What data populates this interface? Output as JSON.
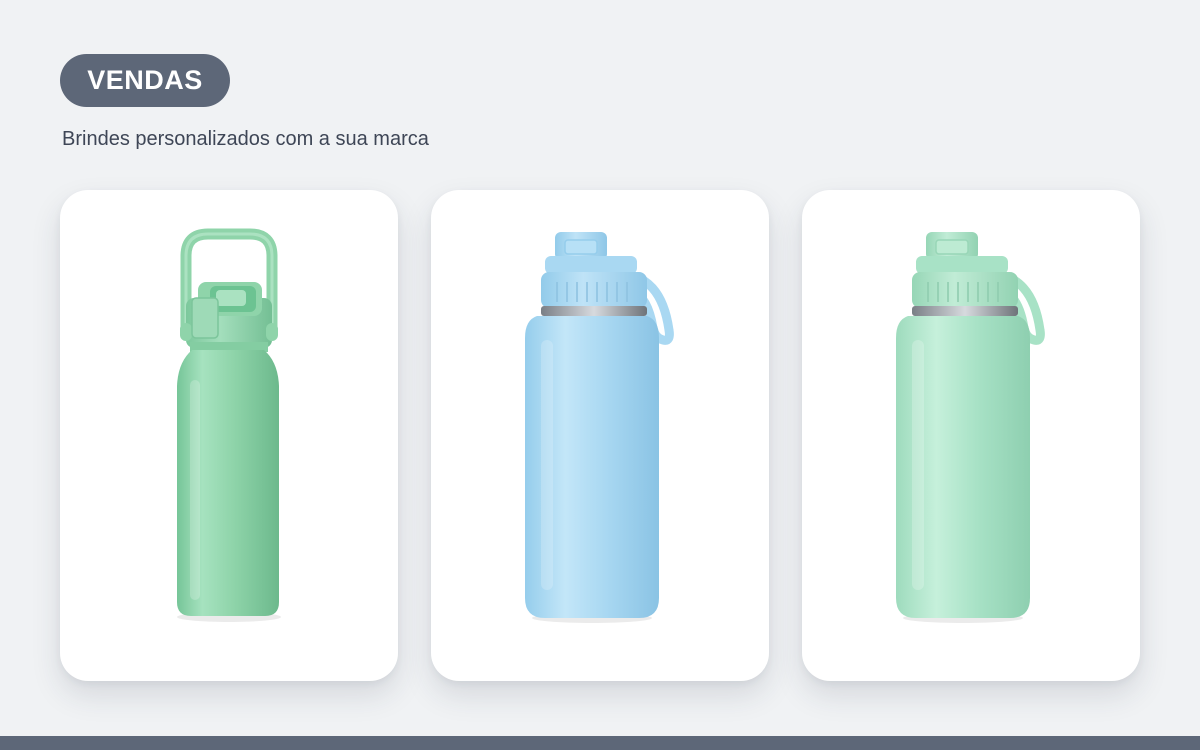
{
  "header": {
    "badge_label": "VENDAS",
    "subtitle": "Brindes personalizados com a sua marca"
  },
  "products": [
    {
      "image": "green-bottle-with-carry-handle",
      "color": "#8fd4aa"
    },
    {
      "image": "light-blue-bottle-with-side-loop",
      "color": "#a9d8f2"
    },
    {
      "image": "mint-bottle-with-side-loop",
      "color": "#a8e2c6"
    }
  ],
  "colors": {
    "background": "#f0f2f4",
    "accent": "#5d6778",
    "card": "#ffffff"
  }
}
